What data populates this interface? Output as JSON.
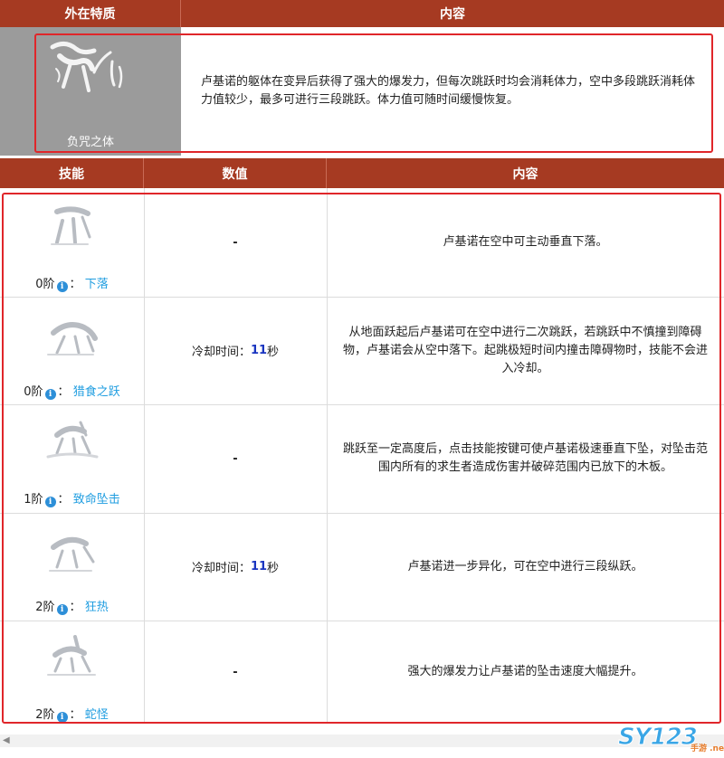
{
  "top_table": {
    "header": {
      "col1": "外在特质",
      "col2": "内容"
    },
    "trait": {
      "name": "负咒之体",
      "icon": "creature-leap-icon",
      "description": "卢基诺的躯体在变异后获得了强大的爆发力，但每次跳跃时均会消耗体力，空中多段跳跃消耗体力值较少，最多可进行三段跳跃。体力值可随时间缓慢恢复。"
    }
  },
  "skills_table": {
    "header": {
      "col1": "技能",
      "col2": "数值",
      "col3": "内容"
    },
    "rows": [
      {
        "tier": "0阶",
        "sep": "：",
        "name": "下落",
        "value_prefix": "",
        "value_num": "",
        "value_suffix": "",
        "value_dash": "-",
        "desc": "卢基诺在空中可主动垂直下落。"
      },
      {
        "tier": "0阶",
        "sep": "：",
        "name": "猎食之跃",
        "value_prefix": "冷却时间：",
        "value_num": "11",
        "value_suffix": "秒",
        "value_dash": "",
        "desc": "从地面跃起后卢基诺可在空中进行二次跳跃，若跳跃中不慎撞到障碍物，卢基诺会从空中落下。起跳极短时间内撞击障碍物时，技能不会进入冷却。"
      },
      {
        "tier": "1阶",
        "sep": "：",
        "name": "致命坠击",
        "value_prefix": "",
        "value_num": "",
        "value_suffix": "",
        "value_dash": "-",
        "desc": "跳跃至一定高度后，点击技能按键可使卢基诺极速垂直下坠，对坠击范围内所有的求生者造成伤害并破碎范围内已放下的木板。"
      },
      {
        "tier": "2阶",
        "sep": "：",
        "name": "狂热",
        "value_prefix": "冷却时间：",
        "value_num": "11",
        "value_suffix": "秒",
        "value_dash": "",
        "desc": "卢基诺进一步异化，可在空中进行三段纵跃。"
      },
      {
        "tier": "2阶",
        "sep": "：",
        "name": "蛇怪",
        "value_prefix": "",
        "value_num": "",
        "value_suffix": "",
        "value_dash": "-",
        "desc": "强大的爆发力让卢基诺的坠击速度大幅提升。"
      }
    ]
  },
  "watermark": {
    "text": "SY123",
    "sub": "手游 .net"
  },
  "colors": {
    "header_bg": "#a63a22",
    "highlight_border": "#e0262a",
    "link": "#1f9de0",
    "value_number": "#1a35c0"
  }
}
